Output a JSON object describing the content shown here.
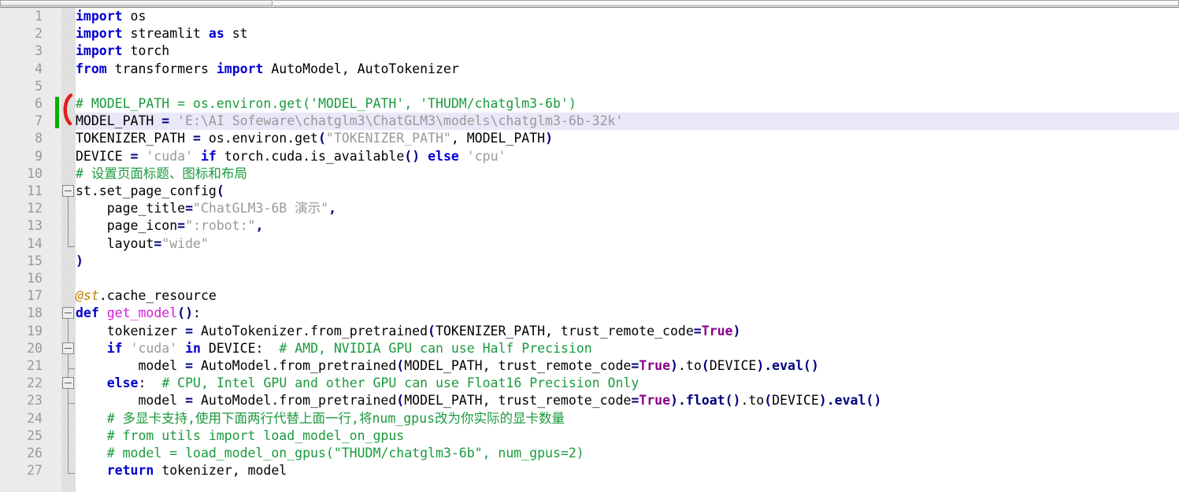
{
  "window": {
    "kind": "code-editor",
    "language": "Python",
    "font_size_px": 16.5
  },
  "scrollbar": {
    "orientation": "horizontal",
    "position": "top",
    "thumb_label": ""
  },
  "colors": {
    "background": "#ffffff",
    "gutter": "#ebebeb",
    "current_line_highlight": "#e8e8f8",
    "line_number": "#999999",
    "keyword": "#0000d0",
    "comment": "#1a9a3c",
    "string": "#999999",
    "constant": "#8b008b",
    "decorator": "#c08000",
    "function_def": "#d81bd8",
    "punctuation": "#000080",
    "change_bar": "#00b000",
    "error_mark": "#e02020"
  },
  "editor": {
    "current_line": 7,
    "changed_lines": [
      6,
      7
    ],
    "fold_markers": [
      11,
      18,
      20,
      22
    ],
    "lines": [
      {
        "n": 1,
        "tokens": [
          {
            "t": "import",
            "c": "kw"
          },
          {
            "t": " os",
            "c": "pl"
          }
        ]
      },
      {
        "n": 2,
        "tokens": [
          {
            "t": "import",
            "c": "kw"
          },
          {
            "t": " streamlit ",
            "c": "pl"
          },
          {
            "t": "as",
            "c": "kw"
          },
          {
            "t": " st",
            "c": "pl"
          }
        ]
      },
      {
        "n": 3,
        "tokens": [
          {
            "t": "import",
            "c": "kw"
          },
          {
            "t": " torch",
            "c": "pl"
          }
        ]
      },
      {
        "n": 4,
        "tokens": [
          {
            "t": "from",
            "c": "kw"
          },
          {
            "t": " transformers ",
            "c": "pl"
          },
          {
            "t": "import",
            "c": "kw"
          },
          {
            "t": " AutoModel, AutoTokenizer",
            "c": "pl"
          }
        ]
      },
      {
        "n": 5,
        "tokens": []
      },
      {
        "n": 6,
        "tokens": [
          {
            "t": "# MODEL_PATH = os.environ.get('MODEL_PATH', 'THUDM/chatglm3-6b')",
            "c": "cm"
          }
        ]
      },
      {
        "n": 7,
        "tokens": [
          {
            "t": "MODEL_PATH ",
            "c": "pl"
          },
          {
            "t": "=",
            "c": "op"
          },
          {
            "t": " ",
            "c": "pl"
          },
          {
            "t": "'E:\\AI Sofeware\\chatglm3\\ChatGLM3\\models\\chatglm3-6b-32k'",
            "c": "str"
          }
        ]
      },
      {
        "n": 8,
        "tokens": [
          {
            "t": "TOKENIZER_PATH ",
            "c": "pl"
          },
          {
            "t": "=",
            "c": "op"
          },
          {
            "t": " os.environ.get",
            "c": "pl"
          },
          {
            "t": "(",
            "c": "pn"
          },
          {
            "t": "\"TOKENIZER_PATH\"",
            "c": "str"
          },
          {
            "t": ", MODEL_PATH",
            "c": "pl"
          },
          {
            "t": ")",
            "c": "pn"
          }
        ]
      },
      {
        "n": 9,
        "tokens": [
          {
            "t": "DEVICE ",
            "c": "pl"
          },
          {
            "t": "=",
            "c": "op"
          },
          {
            "t": " ",
            "c": "pl"
          },
          {
            "t": "'cuda'",
            "c": "str"
          },
          {
            "t": " ",
            "c": "pl"
          },
          {
            "t": "if",
            "c": "kw"
          },
          {
            "t": " torch.cuda.is_available",
            "c": "pl"
          },
          {
            "t": "()",
            "c": "pn"
          },
          {
            "t": " ",
            "c": "pl"
          },
          {
            "t": "else",
            "c": "kw"
          },
          {
            "t": " ",
            "c": "pl"
          },
          {
            "t": "'cpu'",
            "c": "str"
          }
        ]
      },
      {
        "n": 10,
        "tokens": [
          {
            "t": "# 设置页面标题、图标和布局",
            "c": "cm"
          }
        ]
      },
      {
        "n": 11,
        "tokens": [
          {
            "t": "st.set_page_config",
            "c": "pl"
          },
          {
            "t": "(",
            "c": "pn"
          }
        ]
      },
      {
        "n": 12,
        "tokens": [
          {
            "t": "    page_title",
            "c": "pl"
          },
          {
            "t": "=",
            "c": "op"
          },
          {
            "t": "\"ChatGLM3-6B 演示\"",
            "c": "str"
          },
          {
            "t": ",",
            "c": "pn"
          }
        ]
      },
      {
        "n": 13,
        "tokens": [
          {
            "t": "    page_icon",
            "c": "pl"
          },
          {
            "t": "=",
            "c": "op"
          },
          {
            "t": "\":robot:\"",
            "c": "str"
          },
          {
            "t": ",",
            "c": "pn"
          }
        ]
      },
      {
        "n": 14,
        "tokens": [
          {
            "t": "    layout",
            "c": "pl"
          },
          {
            "t": "=",
            "c": "op"
          },
          {
            "t": "\"wide\"",
            "c": "str"
          }
        ]
      },
      {
        "n": 15,
        "tokens": [
          {
            "t": ")",
            "c": "pn"
          }
        ]
      },
      {
        "n": 16,
        "tokens": []
      },
      {
        "n": 17,
        "tokens": [
          {
            "t": "@st",
            "c": "dec"
          },
          {
            "t": ".cache_resource",
            "c": "pl"
          }
        ]
      },
      {
        "n": 18,
        "tokens": [
          {
            "t": "def",
            "c": "kw"
          },
          {
            "t": " ",
            "c": "pl"
          },
          {
            "t": "get_model",
            "c": "defn"
          },
          {
            "t": "()",
            "c": "pn"
          },
          {
            "t": ":",
            "c": "pl"
          }
        ]
      },
      {
        "n": 19,
        "tokens": [
          {
            "t": "    tokenizer ",
            "c": "pl"
          },
          {
            "t": "=",
            "c": "op"
          },
          {
            "t": " AutoTokenizer.from_pretrained",
            "c": "pl"
          },
          {
            "t": "(",
            "c": "pn"
          },
          {
            "t": "TOKENIZER_PATH, trust_remote_code",
            "c": "pl"
          },
          {
            "t": "=",
            "c": "op"
          },
          {
            "t": "True",
            "c": "cnst"
          },
          {
            "t": ")",
            "c": "pn"
          }
        ]
      },
      {
        "n": 20,
        "tokens": [
          {
            "t": "    ",
            "c": "pl"
          },
          {
            "t": "if",
            "c": "kw"
          },
          {
            "t": " ",
            "c": "pl"
          },
          {
            "t": "'cuda'",
            "c": "str"
          },
          {
            "t": " ",
            "c": "pl"
          },
          {
            "t": "in",
            "c": "kw"
          },
          {
            "t": " DEVICE:  ",
            "c": "pl"
          },
          {
            "t": "# AMD, NVIDIA GPU can use Half Precision",
            "c": "cm"
          }
        ]
      },
      {
        "n": 21,
        "tokens": [
          {
            "t": "        model ",
            "c": "pl"
          },
          {
            "t": "=",
            "c": "op"
          },
          {
            "t": " AutoModel.from_pretrained",
            "c": "pl"
          },
          {
            "t": "(",
            "c": "pn"
          },
          {
            "t": "MODEL_PATH, trust_remote_code",
            "c": "pl"
          },
          {
            "t": "=",
            "c": "op"
          },
          {
            "t": "True",
            "c": "cnst"
          },
          {
            "t": ")",
            "c": "pn"
          },
          {
            "t": ".to",
            "c": "pl"
          },
          {
            "t": "(",
            "c": "pn"
          },
          {
            "t": "DEVICE",
            "c": "pl"
          },
          {
            "t": ")",
            "c": "pn"
          },
          {
            "t": ".eval",
            "c": "fn"
          },
          {
            "t": "()",
            "c": "pn"
          }
        ]
      },
      {
        "n": 22,
        "tokens": [
          {
            "t": "    ",
            "c": "pl"
          },
          {
            "t": "else",
            "c": "kw"
          },
          {
            "t": ":  ",
            "c": "pl"
          },
          {
            "t": "# CPU, Intel GPU and other GPU can use Float16 Precision Only",
            "c": "cm"
          }
        ]
      },
      {
        "n": 23,
        "tokens": [
          {
            "t": "        model ",
            "c": "pl"
          },
          {
            "t": "=",
            "c": "op"
          },
          {
            "t": " AutoModel.from_pretrained",
            "c": "pl"
          },
          {
            "t": "(",
            "c": "pn"
          },
          {
            "t": "MODEL_PATH, trust_remote_code",
            "c": "pl"
          },
          {
            "t": "=",
            "c": "op"
          },
          {
            "t": "True",
            "c": "cnst"
          },
          {
            "t": ")",
            "c": "pn"
          },
          {
            "t": ".float",
            "c": "fn"
          },
          {
            "t": "()",
            "c": "pn"
          },
          {
            "t": ".to",
            "c": "pl"
          },
          {
            "t": "(",
            "c": "pn"
          },
          {
            "t": "DEVICE",
            "c": "pl"
          },
          {
            "t": ")",
            "c": "pn"
          },
          {
            "t": ".eval",
            "c": "fn"
          },
          {
            "t": "()",
            "c": "pn"
          }
        ]
      },
      {
        "n": 24,
        "tokens": [
          {
            "t": "    # 多显卡支持,使用下面两行代替上面一行,将num_gpus改为你实际的显卡数量",
            "c": "cm"
          }
        ]
      },
      {
        "n": 25,
        "tokens": [
          {
            "t": "    # from utils import load_model_on_gpus",
            "c": "cm"
          }
        ]
      },
      {
        "n": 26,
        "tokens": [
          {
            "t": "    # model = load_model_on_gpus(\"THUDM/chatglm3-6b\", num_gpus=2)",
            "c": "cm"
          }
        ]
      },
      {
        "n": 27,
        "tokens": [
          {
            "t": "    ",
            "c": "pl"
          },
          {
            "t": "return",
            "c": "kw"
          },
          {
            "t": " tokenizer, model",
            "c": "pl"
          }
        ]
      }
    ]
  }
}
